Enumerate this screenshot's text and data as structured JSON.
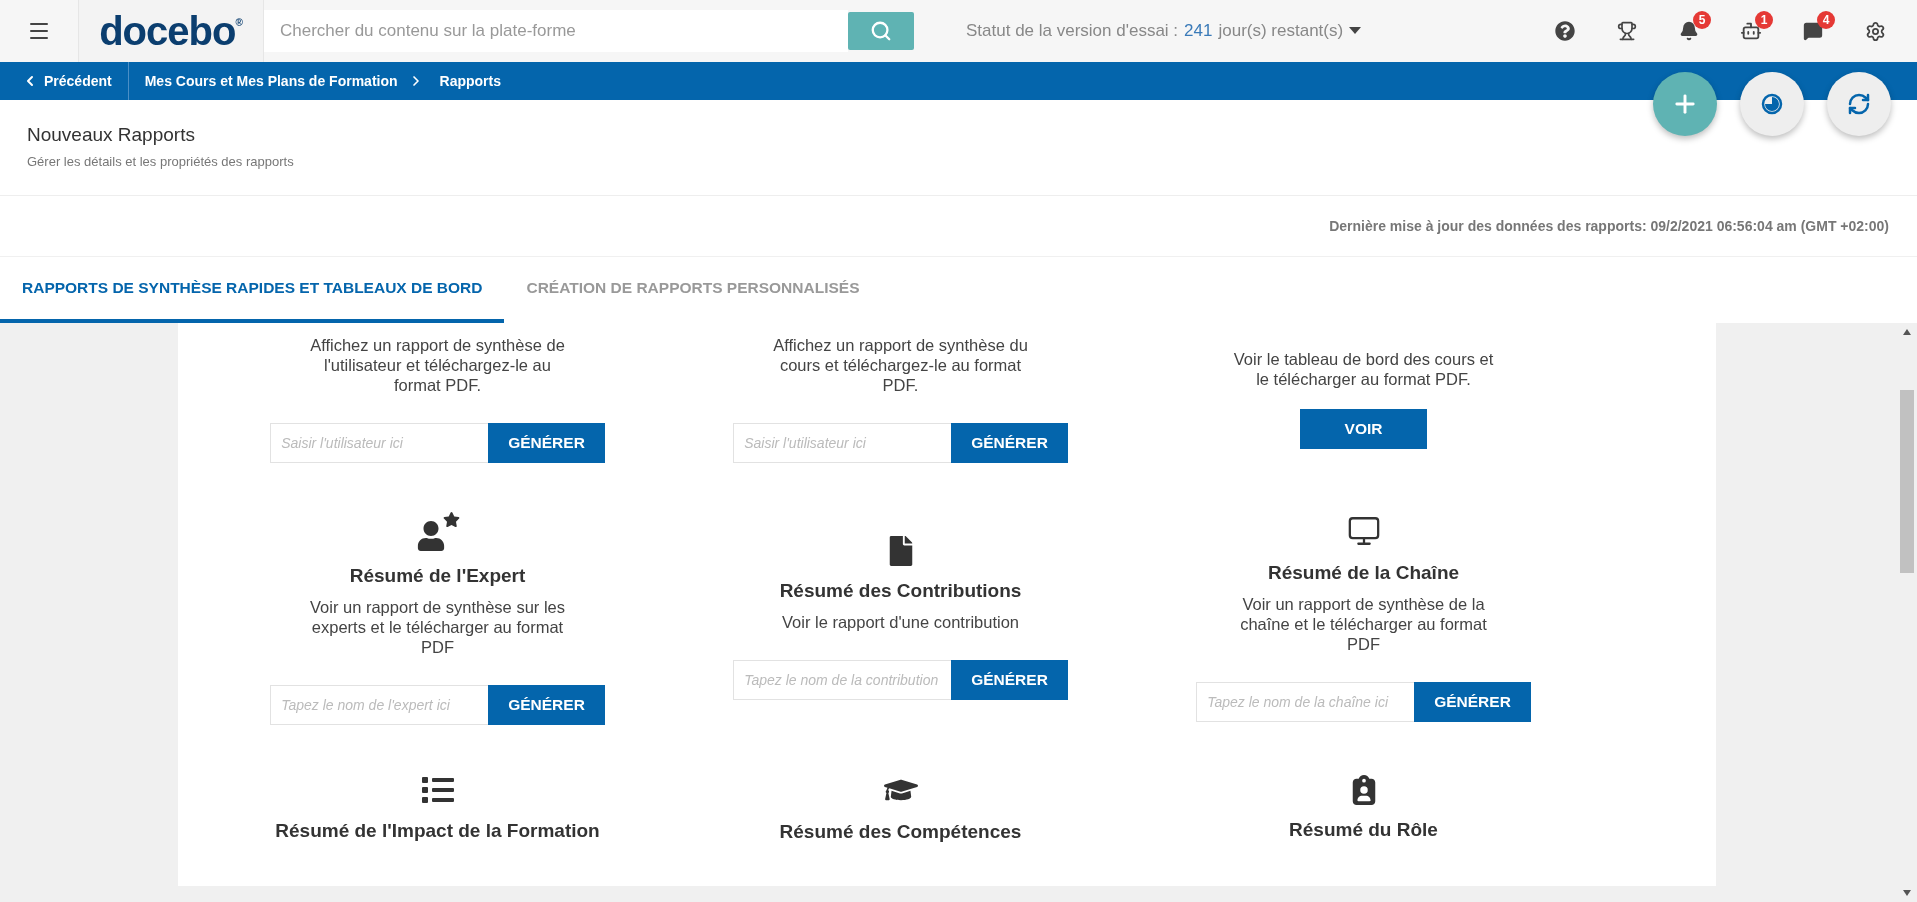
{
  "top_bar": {
    "logo": {
      "name": "docebo",
      "mark": "®"
    },
    "search": {
      "placeholder": "Chercher du contenu sur la plate-forme"
    },
    "trial_status": {
      "label": "Statut de la version d'essai :",
      "days": "241",
      "suffix": "jour(s) restant(s)"
    },
    "icons": [
      {
        "kind": "help"
      },
      {
        "kind": "trophy"
      },
      {
        "kind": "bell",
        "badge": "5"
      },
      {
        "kind": "robot",
        "badge": "1"
      },
      {
        "kind": "chat",
        "badge": "4"
      },
      {
        "kind": "settings"
      }
    ]
  },
  "breadcrumb": {
    "back": "Précédent",
    "items": [
      "Mes Cours et Mes Plans de Formation",
      "Rapports"
    ]
  },
  "fab_buttons": [
    {
      "kind": "add"
    },
    {
      "kind": "dashboard"
    },
    {
      "kind": "refresh"
    }
  ],
  "header": {
    "title": "Nouveaux Rapports",
    "subtitle": "Gérer les détails et les propriétés des rapports"
  },
  "last_update": "Dernière mise à jour des données des rapports: 09/2/2021 06:56:04 am (GMT +02:00)",
  "tabs": [
    {
      "label": "RAPPORTS DE SYNTHÈSE RAPIDES ET TABLEAUX DE BORD",
      "selected": true
    },
    {
      "label": "CRÉATION DE RAPPORTS PERSONNALISÉS",
      "selected": false
    }
  ],
  "reports": [
    {
      "kind": "input",
      "description": "Affichez un rapport de synthèse de l'utilisateur et téléchargez-le au format PDF.",
      "placeholder": "Saisir l'utilisateur ici",
      "button": "GÉNÉRER"
    },
    {
      "kind": "input",
      "description": "Affichez un rapport de synthèse du cours et téléchargez-le au format PDF.",
      "placeholder": "Saisir l'utilisateur ici",
      "button": "GÉNÉRER"
    },
    {
      "kind": "view",
      "description": "Voir le tableau de bord des cours et le télécharger au format PDF.",
      "button": "VOIR"
    },
    {
      "kind": "input",
      "title": "Résumé de l'Expert",
      "description": "Voir un rapport de synthèse sur les experts et le télécharger au format PDF",
      "placeholder": "Tapez le nom de l'expert ici",
      "button": "GÉNÉRER"
    },
    {
      "kind": "input",
      "title": "Résumé des Contributions",
      "description": "Voir le rapport d'une contribution",
      "placeholder": "Tapez le nom de la contribution",
      "button": "GÉNÉRER"
    },
    {
      "kind": "input",
      "title": "Résumé de la Chaîne",
      "description": "Voir un rapport de synthèse de la chaîne et le télécharger au format PDF",
      "placeholder": "Tapez le nom de la chaîne ici",
      "button": "GÉNÉRER"
    },
    {
      "kind": "heading",
      "title": "Résumé de l'Impact de la Formation"
    },
    {
      "kind": "heading",
      "title": "Résumé des Compétences"
    },
    {
      "kind": "heading",
      "title": "Résumé du Rôle"
    }
  ]
}
